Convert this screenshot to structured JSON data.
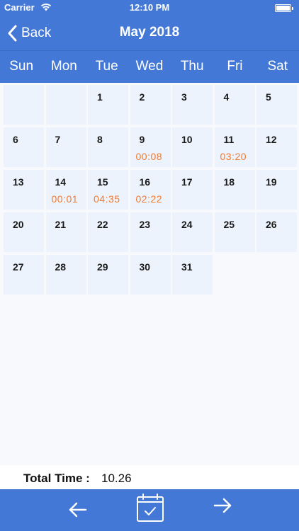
{
  "status": {
    "carrier": "Carrier",
    "time": "12:10 PM"
  },
  "nav": {
    "back_label": "Back",
    "title": "May 2018"
  },
  "weekdays": [
    "Sun",
    "Mon",
    "Tue",
    "Wed",
    "Thu",
    "Fri",
    "Sat"
  ],
  "days": [
    {
      "day": "1",
      "time": ""
    },
    {
      "day": "2",
      "time": ""
    },
    {
      "day": "3",
      "time": ""
    },
    {
      "day": "4",
      "time": ""
    },
    {
      "day": "5",
      "time": ""
    },
    {
      "day": "6",
      "time": ""
    },
    {
      "day": "7",
      "time": ""
    },
    {
      "day": "8",
      "time": ""
    },
    {
      "day": "9",
      "time": "00:08"
    },
    {
      "day": "10",
      "time": ""
    },
    {
      "day": "11",
      "time": "03:20"
    },
    {
      "day": "12",
      "time": ""
    },
    {
      "day": "13",
      "time": ""
    },
    {
      "day": "14",
      "time": "00:01"
    },
    {
      "day": "15",
      "time": "04:35"
    },
    {
      "day": "16",
      "time": "02:22"
    },
    {
      "day": "17",
      "time": ""
    },
    {
      "day": "18",
      "time": ""
    },
    {
      "day": "19",
      "time": ""
    },
    {
      "day": "20",
      "time": ""
    },
    {
      "day": "21",
      "time": ""
    },
    {
      "day": "22",
      "time": ""
    },
    {
      "day": "23",
      "time": ""
    },
    {
      "day": "24",
      "time": ""
    },
    {
      "day": "25",
      "time": ""
    },
    {
      "day": "26",
      "time": ""
    },
    {
      "day": "27",
      "time": ""
    },
    {
      "day": "28",
      "time": ""
    },
    {
      "day": "29",
      "time": ""
    },
    {
      "day": "30",
      "time": ""
    },
    {
      "day": "31",
      "time": ""
    }
  ],
  "total": {
    "label": "Total Time :",
    "value": "10.26"
  },
  "toolbar": {
    "prev_icon": "arrow-left-icon",
    "today_icon": "calendar-check-icon",
    "next_icon": "arrow-right-icon"
  },
  "colors": {
    "accent": "#4378d6",
    "cell_bg": "#edf3fd",
    "time_text": "#f07a30"
  }
}
